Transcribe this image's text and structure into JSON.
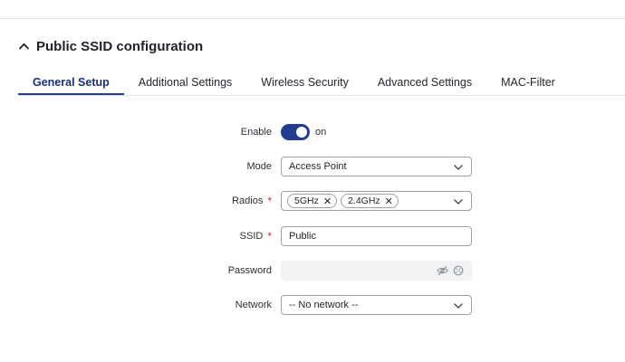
{
  "section": {
    "title": "Public SSID configuration",
    "expanded": true
  },
  "tabs": [
    {
      "label": "General Setup",
      "active": true
    },
    {
      "label": "Additional Settings",
      "active": false
    },
    {
      "label": "Wireless Security",
      "active": false
    },
    {
      "label": "Advanced Settings",
      "active": false
    },
    {
      "label": "MAC-Filter",
      "active": false
    }
  ],
  "form": {
    "enable": {
      "label": "Enable",
      "state": "on",
      "checked": true
    },
    "mode": {
      "label": "Mode",
      "value": "Access Point"
    },
    "radios": {
      "label": "Radios",
      "required_mark": "*",
      "chips": [
        "5GHz",
        "2.4GHz"
      ],
      "remove_glyph": "✕"
    },
    "ssid": {
      "label": "SSID",
      "required_mark": "*",
      "value": "Public"
    },
    "password": {
      "label": "Password",
      "value": "",
      "icons": [
        "eye-off-icon",
        "generate-icon"
      ]
    },
    "network": {
      "label": "Network",
      "value": "-- No network --"
    }
  },
  "colors": {
    "accent": "#233e91",
    "required": "#d6262f",
    "border": "#9aa1a9"
  }
}
